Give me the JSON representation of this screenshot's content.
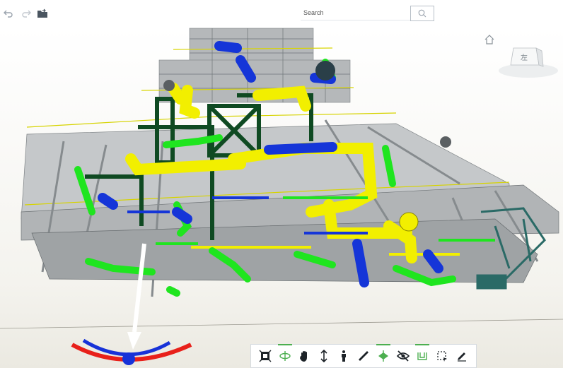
{
  "toolbar_top": {
    "undo_icon": "undo-icon",
    "redo_icon": "redo-icon",
    "open_icon": "open-model-icon"
  },
  "search": {
    "placeholder": "Search",
    "value": ""
  },
  "view_cube": {
    "face_label": "左"
  },
  "colors": {
    "pipe_yellow": "#f2ef00",
    "pipe_green": "#1fe51f",
    "pipe_blue": "#1535d8",
    "structure_grey": "#a8acae",
    "dark_green": "#0f4a22",
    "teal": "#2a6a66",
    "accent_active": "#4caf50"
  },
  "bottom_toolbar": [
    {
      "name": "fit-view-icon"
    },
    {
      "name": "orbit-icon",
      "active": true
    },
    {
      "name": "pan-icon"
    },
    {
      "name": "zoom-icon"
    },
    {
      "name": "first-person-icon"
    },
    {
      "name": "measure-icon"
    },
    {
      "name": "section-icon",
      "active": true
    },
    {
      "name": "hide-icon"
    },
    {
      "name": "explode-icon",
      "active": true
    },
    {
      "name": "select-box-icon"
    },
    {
      "name": "markup-icon"
    }
  ]
}
